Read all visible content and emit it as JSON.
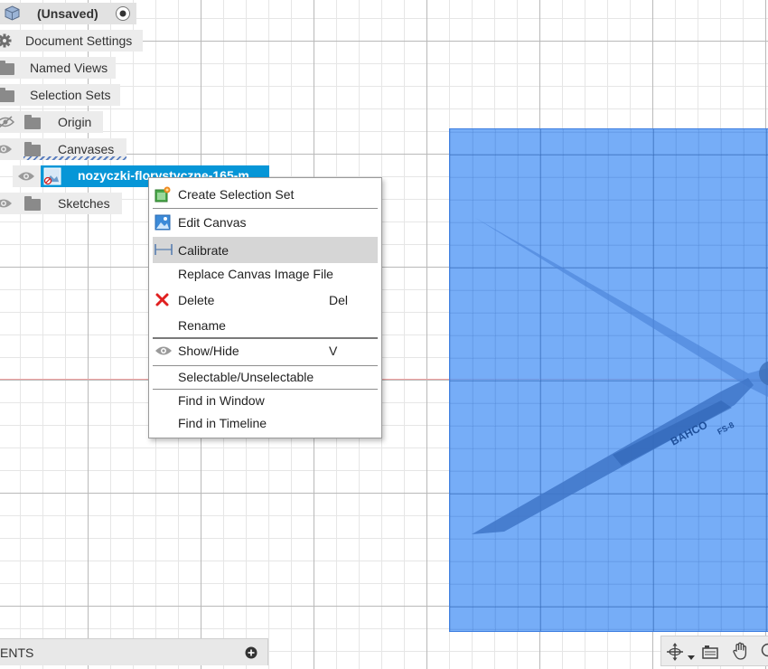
{
  "browser": {
    "doc_title": "(Unsaved)",
    "items": {
      "document_settings": "Document Settings",
      "named_views": "Named Views",
      "selection_sets": "Selection Sets",
      "origin": "Origin",
      "canvases": "Canvases",
      "canvas_item": "nozyczki-florystyczne-165-m...",
      "sketches": "Sketches"
    }
  },
  "context_menu": {
    "create_selection_set": "Create Selection Set",
    "edit_canvas": "Edit Canvas",
    "calibrate": "Calibrate",
    "replace_canvas_image_file": "Replace Canvas Image File",
    "delete": "Delete",
    "delete_shortcut": "Del",
    "rename": "Rename",
    "show_hide": "Show/Hide",
    "show_hide_shortcut": "V",
    "selectable_unselectable": "Selectable/Unselectable",
    "find_in_window": "Find in Window",
    "find_in_timeline": "Find in Timeline"
  },
  "canvas_image": {
    "brand_text": "BAHCO",
    "model_text": "FS-8"
  },
  "comments": {
    "label": "ENTS"
  },
  "colors": {
    "selection_blue": "#0696d7",
    "canvas_blue": "#5096f5",
    "delete_red": "#e02020"
  },
  "icons": {
    "settings": "gear-icon",
    "visibility": "eye-icon",
    "hidden": "eye-slash-icon",
    "folder": "folder-icon",
    "add": "plus-circle-icon",
    "orbit": "orbit-icon",
    "pan": "pan-hand-icon",
    "look_at": "camera-icon"
  }
}
